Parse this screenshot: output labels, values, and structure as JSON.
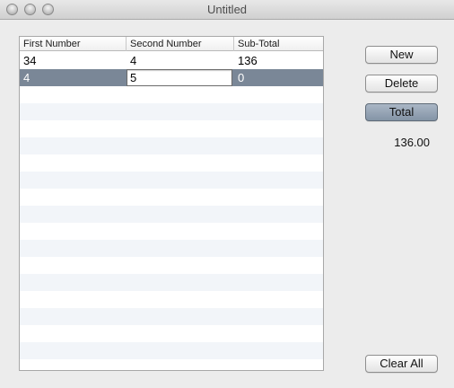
{
  "window": {
    "title": "Untitled"
  },
  "table": {
    "columns": [
      "First Number",
      "Second Number",
      "Sub-Total"
    ],
    "rows": [
      {
        "first": "34",
        "second": "4",
        "subtotal": "136"
      },
      {
        "first": "4",
        "second": "5",
        "subtotal": "0"
      }
    ],
    "selected_row": 1,
    "editing_value": "5"
  },
  "buttons": {
    "new": "New",
    "delete": "Delete",
    "total": "Total",
    "clear_all": "Clear All"
  },
  "total_display": "136.00"
}
